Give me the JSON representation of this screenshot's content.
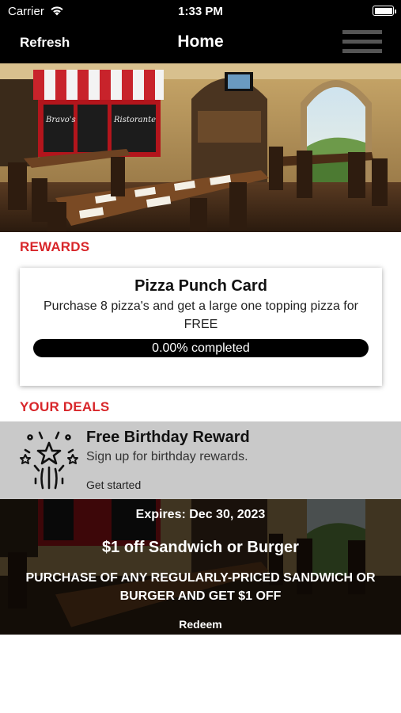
{
  "status_bar": {
    "carrier": "Carrier",
    "time": "1:33 PM"
  },
  "nav": {
    "refresh_label": "Refresh",
    "title": "Home",
    "menu_icon": "hamburger-menu-icon"
  },
  "rewards": {
    "heading": "REWARDS",
    "punch_card": {
      "title": "Pizza Punch Card",
      "description": "Purchase 8 pizza's and get a large one topping pizza for FREE",
      "progress_fraction": 0.0,
      "progress_label": "0.00% completed"
    }
  },
  "deals": {
    "heading": "YOUR DEALS",
    "birthday": {
      "icon": "fireworks-icon",
      "title": "Free Birthday Reward",
      "subtitle": "Sign up for birthday rewards.",
      "cta": "Get started"
    },
    "sandwich": {
      "expires": "Expires: Dec 30, 2023",
      "title": "$1 off Sandwich or Burger",
      "description": "PURCHASE OF ANY REGULARLY-PRICED SANDWICH OR BURGER AND GET $1 OFF",
      "cta": "Redeem"
    }
  },
  "colors": {
    "brand_red": "#d8262a",
    "nav_background": "#000000",
    "deal_gray": "#c9c9c9"
  }
}
